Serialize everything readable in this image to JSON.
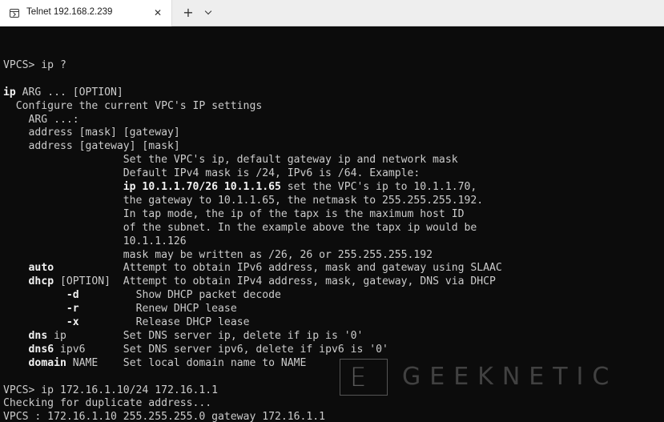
{
  "tab": {
    "title": "Telnet 192.168.2.239",
    "icon": "terminal-icon",
    "close_glyph": "✕"
  },
  "toolbar": {
    "new_tab_glyph": "+",
    "dropdown_icon": "chevron-down-icon"
  },
  "terminal": {
    "lines": [
      "",
      "VPCS> ip ?",
      "",
      "**ip** ARG ... [OPTION]",
      "  Configure the current VPC's IP settings",
      "    ARG ...:",
      "    address [mask] [gateway]",
      "    address [gateway] [mask]",
      "                   Set the VPC's ip, default gateway ip and network mask",
      "                   Default IPv4 mask is /24, IPv6 is /64. Example:",
      "                   **ip 10.1.1.70/26 10.1.1.65** set the VPC's ip to 10.1.1.70,",
      "                   the gateway to 10.1.1.65, the netmask to 255.255.255.192.",
      "                   In tap mode, the ip of the tapx is the maximum host ID",
      "                   of the subnet. In the example above the tapx ip would be",
      "                   10.1.1.126",
      "                   mask may be written as /26, 26 or 255.255.255.192",
      "    **auto**           Attempt to obtain IPv6 address, mask and gateway using SLAAC",
      "    **dhcp** [OPTION]  Attempt to obtain IPv4 address, mask, gateway, DNS via DHCP",
      "          **-d**         Show DHCP packet decode",
      "          **-r**         Renew DHCP lease",
      "          **-x**         Release DHCP lease",
      "    **dns** ip         Set DNS server ip, delete if ip is '0'",
      "    **dns6** ipv6      Set DNS server ipv6, delete if ipv6 is '0'",
      "    **domain** NAME    Set local domain name to NAME",
      "",
      "VPCS> ip 172.16.1.10/24 172.16.1.1",
      "Checking for duplicate address...",
      "VPCS : 172.16.1.10 255.255.255.0 gateway 172.16.1.1"
    ]
  },
  "watermark": {
    "letter": "E",
    "text": "GEEKNETIC"
  },
  "colors": {
    "terminal_bg": "#0c0c0c",
    "terminal_fg": "#cccccc",
    "tabbar_bg": "#eeeeee"
  }
}
